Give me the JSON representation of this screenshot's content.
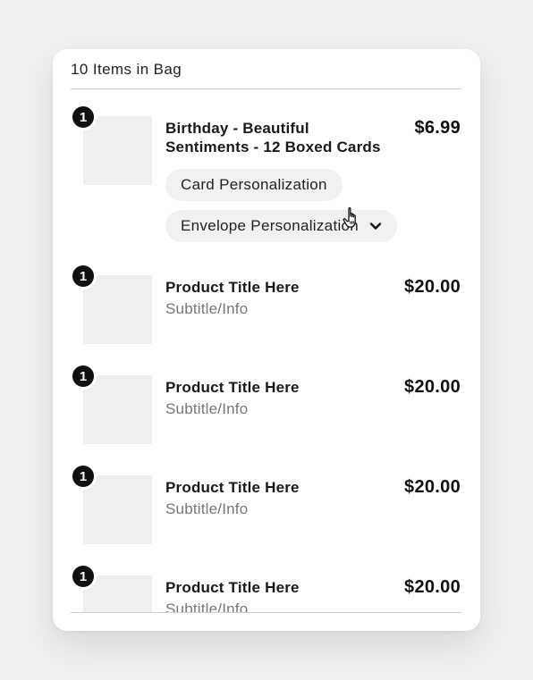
{
  "bag": {
    "header": "10 Items in Bag"
  },
  "items": [
    {
      "qty": "1",
      "title": "Birthday - Beautiful Sentiments - 12 Boxed Cards",
      "price": "$6.99",
      "options": [
        {
          "label": "Card Personalization"
        },
        {
          "label": "Envelope Personalization"
        }
      ]
    },
    {
      "qty": "1",
      "title": "Product Title Here",
      "subtitle": "Subtitle/Info",
      "price": "$20.00"
    },
    {
      "qty": "1",
      "title": "Product Title Here",
      "subtitle": "Subtitle/Info",
      "price": "$20.00"
    },
    {
      "qty": "1",
      "title": "Product Title Here",
      "subtitle": "Subtitle/Info",
      "price": "$20.00"
    },
    {
      "qty": "1",
      "title": "Product Title Here",
      "subtitle": "Subtitle/Info",
      "price": "$20.00"
    }
  ],
  "icons": {
    "dropdown": "chevron-down-icon",
    "pointer": "hand-pointer-cursor-icon"
  }
}
